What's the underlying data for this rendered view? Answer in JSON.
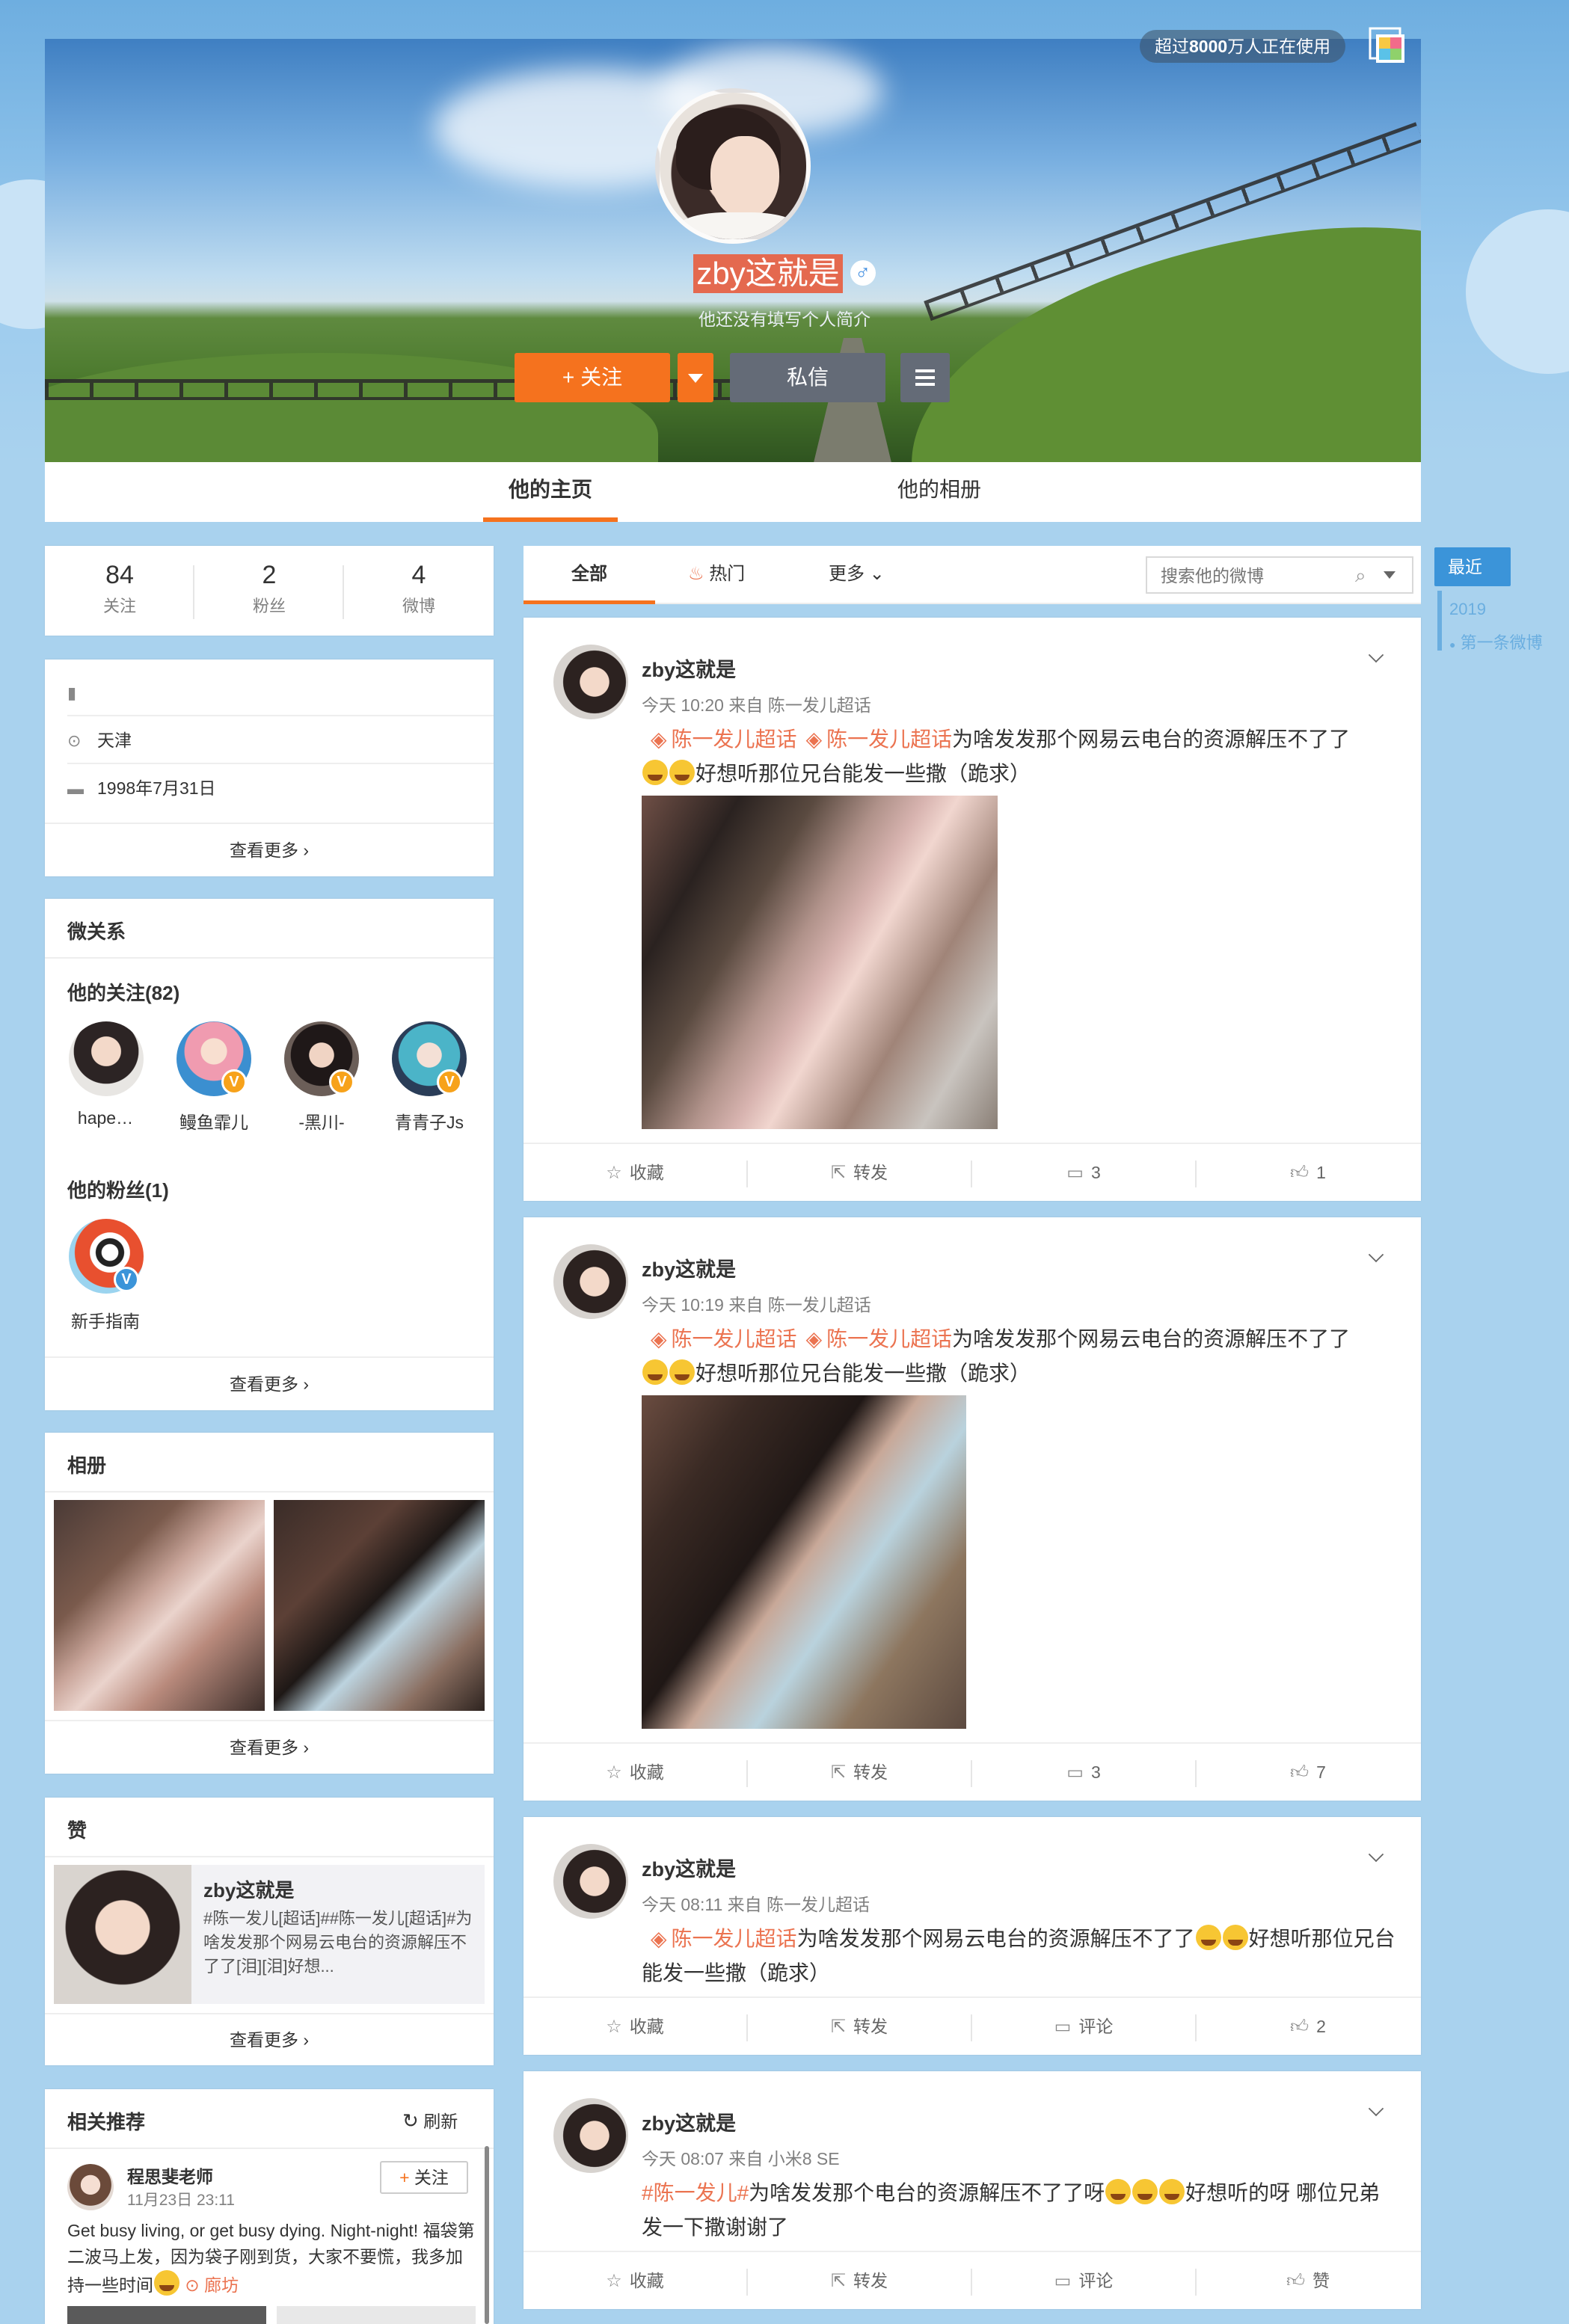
{
  "header": {
    "usage_prefix": "超过",
    "usage_count": "8000",
    "usage_suffix": "万人正在使用",
    "nickname": "zby这就是",
    "gender_icon": "male-icon",
    "bio": "他还没有填写个人简介",
    "follow_label": "关注",
    "message_label": "私信"
  },
  "tabs": [
    {
      "label": "他的主页",
      "active": true
    },
    {
      "label": "他的相册",
      "active": false
    }
  ],
  "stats": [
    {
      "value": "84",
      "label": "关注"
    },
    {
      "value": "2",
      "label": "粉丝"
    },
    {
      "value": "4",
      "label": "微博"
    }
  ],
  "info": {
    "location": "天津",
    "birthday": "1998年7月31日",
    "more": "查看更多"
  },
  "relations": {
    "title": "微关系",
    "following_title": "他的关注(82)",
    "following": [
      {
        "name": "hape…",
        "verified": false
      },
      {
        "name": "鳗鱼霏儿",
        "verified": true
      },
      {
        "name": "-黑川-",
        "verified": true
      },
      {
        "name": "青青子Js",
        "verified": true
      }
    ],
    "fans_title": "他的粉丝(1)",
    "fans": [
      {
        "name": "新手指南",
        "verified": true
      }
    ],
    "more": "查看更多"
  },
  "album": {
    "title": "相册",
    "more": "查看更多"
  },
  "likes": {
    "title": "赞",
    "item_name": "zby这就是",
    "item_text": "#陈一发儿[超话]##陈一发儿[超话]#为啥发发那个网易云电台的资源解压不了了[泪][泪]好想...",
    "more": "查看更多"
  },
  "recommend": {
    "title": "相关推荐",
    "refresh": "刷新",
    "name": "程思斐老师",
    "time": "11月23日 23:11",
    "follow": "关注",
    "text": "Get busy living, or get busy dying. Night-night! 福袋第二波马上发，因为袋子刚到货，大家不要慌，我多加持一些时间",
    "location": "廊坊"
  },
  "feed_tabs": {
    "all": "全部",
    "hot": "热门",
    "more": "更多",
    "search_placeholder": "搜索他的微博"
  },
  "timeline": {
    "recent": "最近",
    "year": "2019",
    "first": "第一条微博"
  },
  "posts": [
    {
      "name": "zby这就是",
      "meta": "今天 10:20 来自 陈一发儿超话",
      "tag1": "陈一发儿超话",
      "tag2": "陈一发儿超话",
      "text1": "为啥发发那个网易云电台的资源解压不了了",
      "text2": "好想听那位兄台能发一些撒（跪求）",
      "fav": "收藏",
      "repost": "转发",
      "comment": "3",
      "like": "1"
    },
    {
      "name": "zby这就是",
      "meta": "今天 10:19 来自 陈一发儿超话",
      "tag1": "陈一发儿超话",
      "tag2": "陈一发儿超话",
      "text1": "为啥发发那个网易云电台的资源解压不了了",
      "text2": "好想听那位兄台能发一些撒（跪求）",
      "fav": "收藏",
      "repost": "转发",
      "comment": "3",
      "like": "7"
    },
    {
      "name": "zby这就是",
      "meta": "今天 08:11 来自 陈一发儿超话",
      "tag1": "陈一发儿超话",
      "text1": "为啥发发那个网易云电台的资源解压不了了",
      "text2": "好想听那位兄台能发一些撒（跪求）",
      "fav": "收藏",
      "repost": "转发",
      "comment": "评论",
      "like": "2"
    },
    {
      "name": "zby这就是",
      "meta": "今天 08:07 来自 小米8 SE",
      "tag1": "#陈一发儿#",
      "text1": "为啥发发那个电台的资源解压不了了呀",
      "text2": "好想听的呀 哪位兄弟发一下撒谢谢了",
      "fav": "收藏",
      "repost": "转发",
      "comment": "评论",
      "like": "赞"
    }
  ],
  "colors": {
    "accent": "#f5721e",
    "tag": "#eb7350",
    "link_blue": "#3b94d9",
    "page_bg": "#a9d2ee"
  }
}
